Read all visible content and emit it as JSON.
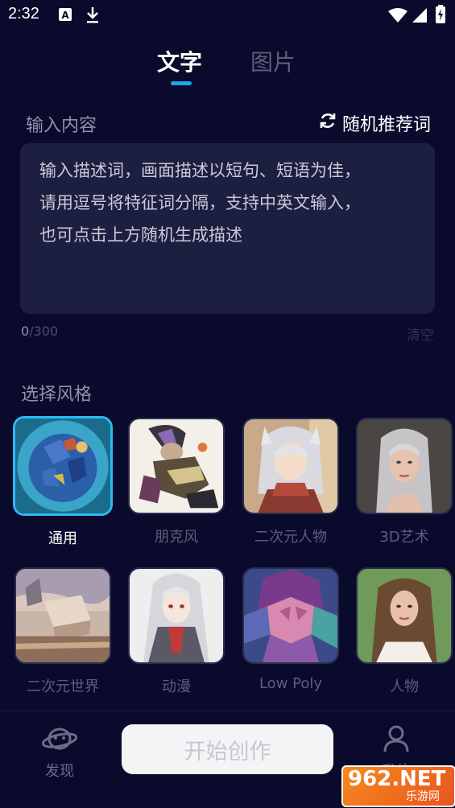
{
  "status_bar": {
    "time": "2:32",
    "icons": [
      "a-notification-icon",
      "download-icon",
      "wifi-icon",
      "signal-icon",
      "battery-charging-icon"
    ]
  },
  "tabs": [
    {
      "label": "文字",
      "selected": true
    },
    {
      "label": "图片",
      "selected": false
    }
  ],
  "input": {
    "label": "输入内容",
    "random_label": "随机推荐词",
    "random_icon": "refresh-icon",
    "placeholder": "输入描述词，画面描述以短句、短语为佳，\n请用逗号将特征词分隔，支持中英文输入，\n也可点击上方随机生成描述",
    "count_current": "0",
    "count_max": "/300",
    "clear_label": "清空"
  },
  "styles": {
    "label": "选择风格",
    "items": [
      {
        "name": "通用",
        "selected": true
      },
      {
        "name": "朋克风",
        "selected": false
      },
      {
        "name": "二次元人物",
        "selected": false
      },
      {
        "name": "3D艺术",
        "selected": false
      },
      {
        "name": "二次元世界",
        "selected": false
      },
      {
        "name": "动漫",
        "selected": false
      },
      {
        "name": "Low Poly",
        "selected": false
      },
      {
        "name": "人物",
        "selected": false
      }
    ]
  },
  "bottom_nav": {
    "discover_label": "发现",
    "start_label": "开始创作",
    "me_label": "我的"
  },
  "watermark": {
    "main": "962.NET",
    "sub": "乐游网"
  },
  "colors": {
    "background": "#0a0a2c",
    "accent": "#19a7e8",
    "input_bg": "#1d1f40"
  }
}
